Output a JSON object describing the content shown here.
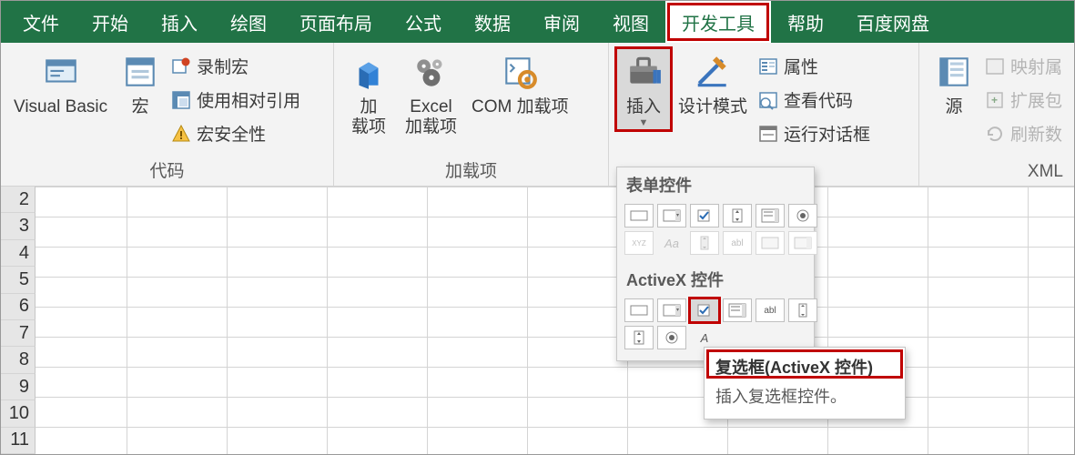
{
  "tabs": {
    "file": "文件",
    "home": "开始",
    "insert": "插入",
    "draw": "绘图",
    "layout": "页面布局",
    "formula": "公式",
    "data": "数据",
    "review": "审阅",
    "view": "视图",
    "developer": "开发工具",
    "help": "帮助",
    "baidu": "百度网盘"
  },
  "code_group": {
    "visual_basic": "Visual Basic",
    "macros": "宏",
    "record_macro": "录制宏",
    "use_relative": "使用相对引用",
    "macro_security": "宏安全性",
    "label": "代码"
  },
  "addins_group": {
    "addins_l1": "加",
    "addins_l2": "载项",
    "excel_l1": "Excel",
    "excel_l2": "加载项",
    "com": "COM 加载项",
    "label": "加载项"
  },
  "controls_group": {
    "insert": "插入",
    "design": "设计模式",
    "properties": "属性",
    "view_code": "查看代码",
    "run_dialog": "运行对话框"
  },
  "xml_group": {
    "source": "源",
    "map_props": "映射属",
    "expansion": "扩展包",
    "refresh": "刷新数",
    "label": "XML"
  },
  "gallery": {
    "form_header": "表单控件",
    "activex_header": "ActiveX 控件",
    "aa": "Aa",
    "abl": "abl",
    "xyz": "XYZ",
    "a_more": "A"
  },
  "tooltip": {
    "title": "复选框(ActiveX 控件)",
    "body": "插入复选框控件。"
  },
  "rows": [
    2,
    3,
    4,
    5,
    6,
    7,
    8,
    9,
    10,
    11
  ]
}
